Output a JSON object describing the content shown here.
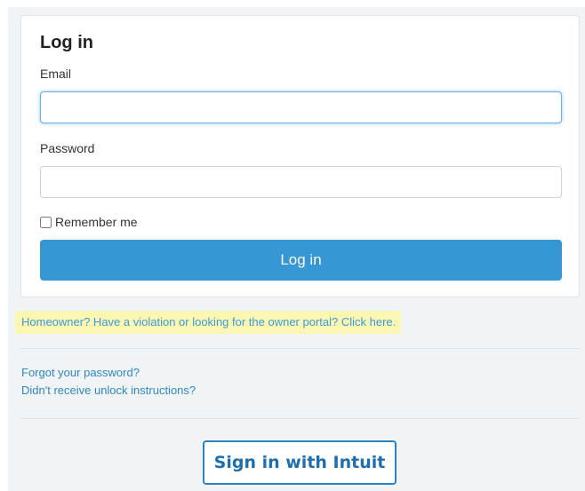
{
  "login_card": {
    "title": "Log in",
    "email_label": "Email",
    "email_value": "",
    "password_label": "Password",
    "password_value": "",
    "remember_label": "Remember me",
    "remember_checked": false,
    "submit_label": "Log in"
  },
  "homeowner_link": "Homeowner? Have a violation or looking for the owner portal? Click here.",
  "links": {
    "forgot_password": "Forgot your password?",
    "unlock_instructions": "Didn't receive unlock instructions?"
  },
  "intuit_button": "Sign in with Intuit",
  "colors": {
    "primary_button": "#3797d4",
    "link": "#2f87c3",
    "highlight": "#fbf7b3",
    "intuit_border": "#2a83c3"
  }
}
